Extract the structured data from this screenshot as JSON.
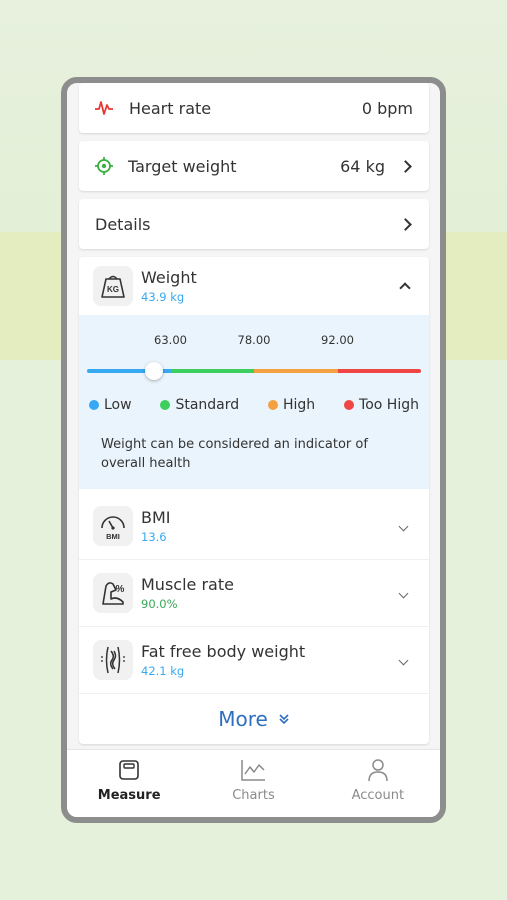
{
  "cards": {
    "heart_rate": {
      "label": "Heart rate",
      "value": "0 bpm"
    },
    "target_weight": {
      "label": "Target weight",
      "value": "64 kg"
    },
    "details": {
      "label": "Details"
    }
  },
  "weight": {
    "name": "Weight",
    "icon_text": "KG",
    "value": "43.9 kg",
    "scale": {
      "thresholds": [
        "63.00",
        "78.00",
        "92.00"
      ],
      "current_fraction": 0.2
    },
    "legend": [
      {
        "label": "Low",
        "color": "#36a9f2"
      },
      {
        "label": "Standard",
        "color": "#3ccf5d"
      },
      {
        "label": "High",
        "color": "#f5a142"
      },
      {
        "label": "Too High",
        "color": "#ef4545"
      }
    ],
    "description": "Weight can be considered an indicator of overall health"
  },
  "metrics": [
    {
      "name": "BMI",
      "value": "13.6",
      "color": "#36a9f2",
      "icon": "gauge-icon",
      "icon_text": "BMI"
    },
    {
      "name": "Muscle rate",
      "value": "90.0%",
      "color": "#3aa85a",
      "icon": "muscle-icon",
      "icon_text": "%"
    },
    {
      "name": "Fat free body weight",
      "value": "42.1 kg",
      "color": "#36a9f2",
      "icon": "body-icon"
    }
  ],
  "more": {
    "label": "More"
  },
  "tabs": [
    {
      "label": "Measure",
      "icon": "scale-icon",
      "active": true
    },
    {
      "label": "Charts",
      "icon": "chart-icon",
      "active": false
    },
    {
      "label": "Account",
      "icon": "person-icon",
      "active": false
    }
  ],
  "colors": {
    "accent": "#2f6fbf",
    "heart": "#e53935",
    "target": "#3cb043"
  }
}
